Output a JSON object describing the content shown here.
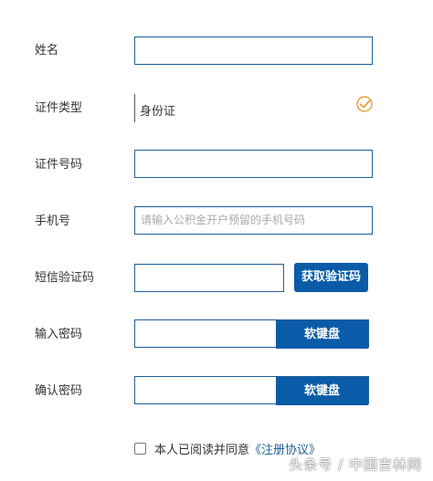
{
  "form": {
    "name_label": "姓名",
    "id_type_label": "证件类型",
    "id_type_value": "身份证",
    "id_number_label": "证件号码",
    "phone_label": "手机号",
    "phone_placeholder": "请输入公积金开户预留的手机号码",
    "sms_label": "短信验证码",
    "sms_button": "获取验证码",
    "password_label": "输入密码",
    "confirm_password_label": "确认密码",
    "keyboard_button": "软键盘",
    "agree_text": "本人已阅读并同意",
    "agree_link": "《注册协议》"
  },
  "watermark": "头条号 / 中国吉林网",
  "colors": {
    "accent": "#0b5ca8",
    "border": "#1f5e9a",
    "check_icon": "#e8a23a"
  },
  "icons": {
    "select_check": "check-circle-icon",
    "agree_checkbox": "checkbox"
  }
}
